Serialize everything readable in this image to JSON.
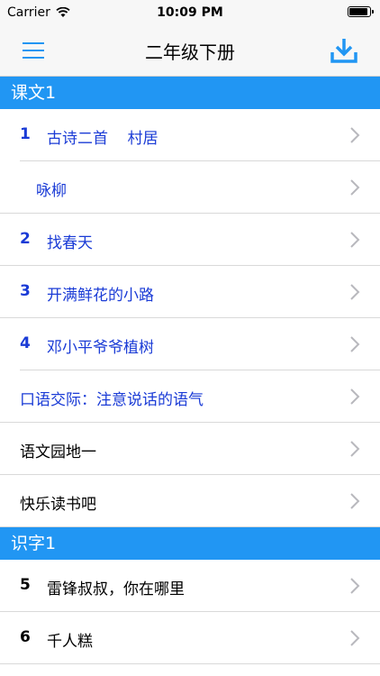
{
  "status": {
    "carrier": "Carrier",
    "time": "10:09 PM",
    "battery_level": 0.9
  },
  "nav": {
    "title": "二年级下册"
  },
  "sections": [
    {
      "title": "课文1",
      "items": [
        {
          "num": "1",
          "label": "古诗二首    村居"
        },
        {
          "num": "",
          "label": "咏柳"
        },
        {
          "num": "2",
          "label": "找春天"
        },
        {
          "num": "3",
          "label": "开满鲜花的小路"
        },
        {
          "num": "4",
          "label": "邓小平爷爷植树"
        },
        {
          "num": "",
          "label": "口语交际：注意说话的语气"
        },
        {
          "num": "",
          "label": "语文园地一"
        },
        {
          "num": "",
          "label": "快乐读书吧"
        }
      ]
    },
    {
      "title": "识字1",
      "items": [
        {
          "num": "5",
          "label": "雷锋叔叔，你在哪里"
        },
        {
          "num": "6",
          "label": "千人糕"
        }
      ]
    }
  ],
  "colors": {
    "accent": "#2196f3",
    "link_blue": "#1a3bd6"
  },
  "icons": {
    "menu": "menu-icon",
    "download": "download-icon",
    "chevron": "chevron-right-icon"
  }
}
